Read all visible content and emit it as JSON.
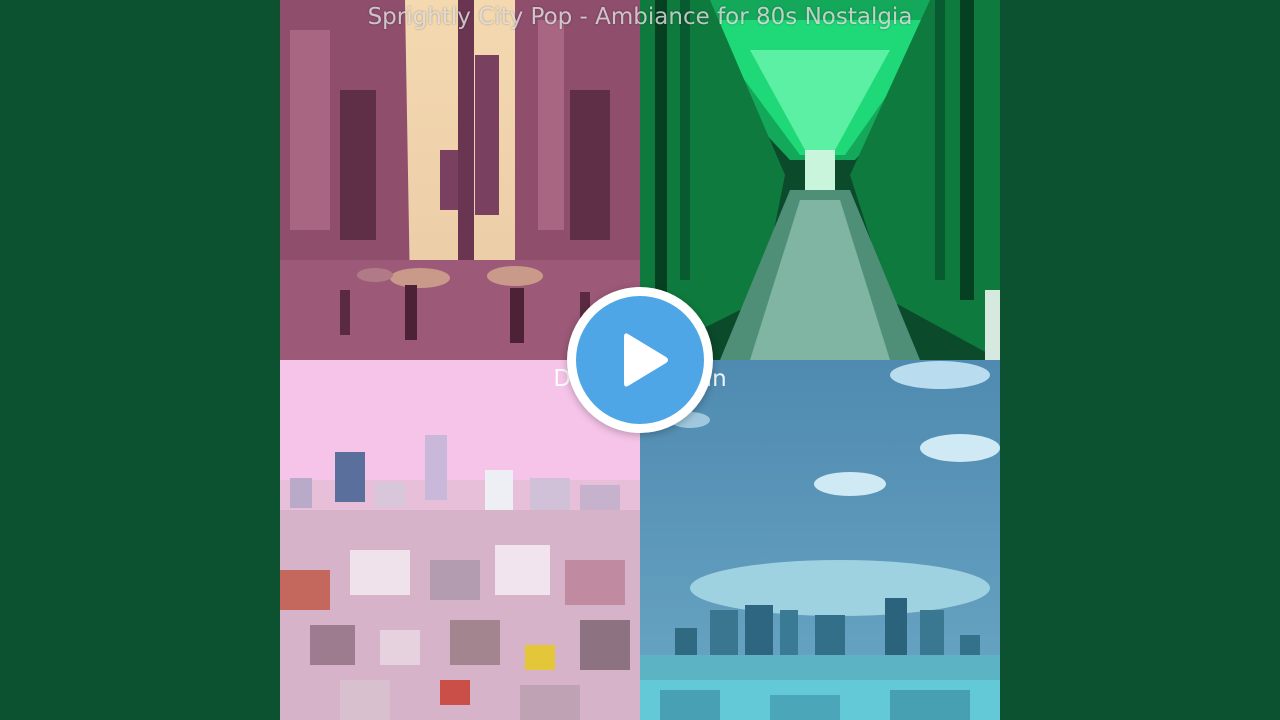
{
  "video": {
    "cover_title": "Sprightly City Pop - Ambiance for 80s Nostalgia",
    "cover_subtitle": "Dazzling Japan",
    "play_icon": "play-icon",
    "colors": {
      "background": "#0d5230",
      "play_button": "#4ea6e6"
    }
  }
}
